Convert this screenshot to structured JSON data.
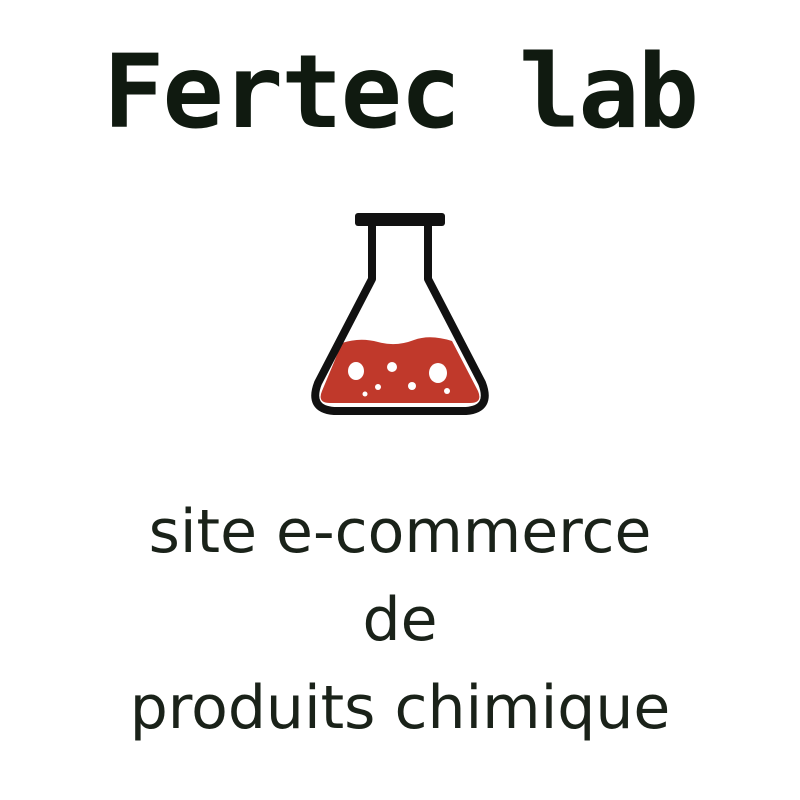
{
  "brand": {
    "title": "Fertec lab",
    "logo_icon": "chemistry-flask-icon",
    "accent_color": "#c0392b",
    "text_color": "#101a10"
  },
  "tagline": {
    "line1": "site e-commerce",
    "line2": "de",
    "line3": "produits chimique"
  }
}
